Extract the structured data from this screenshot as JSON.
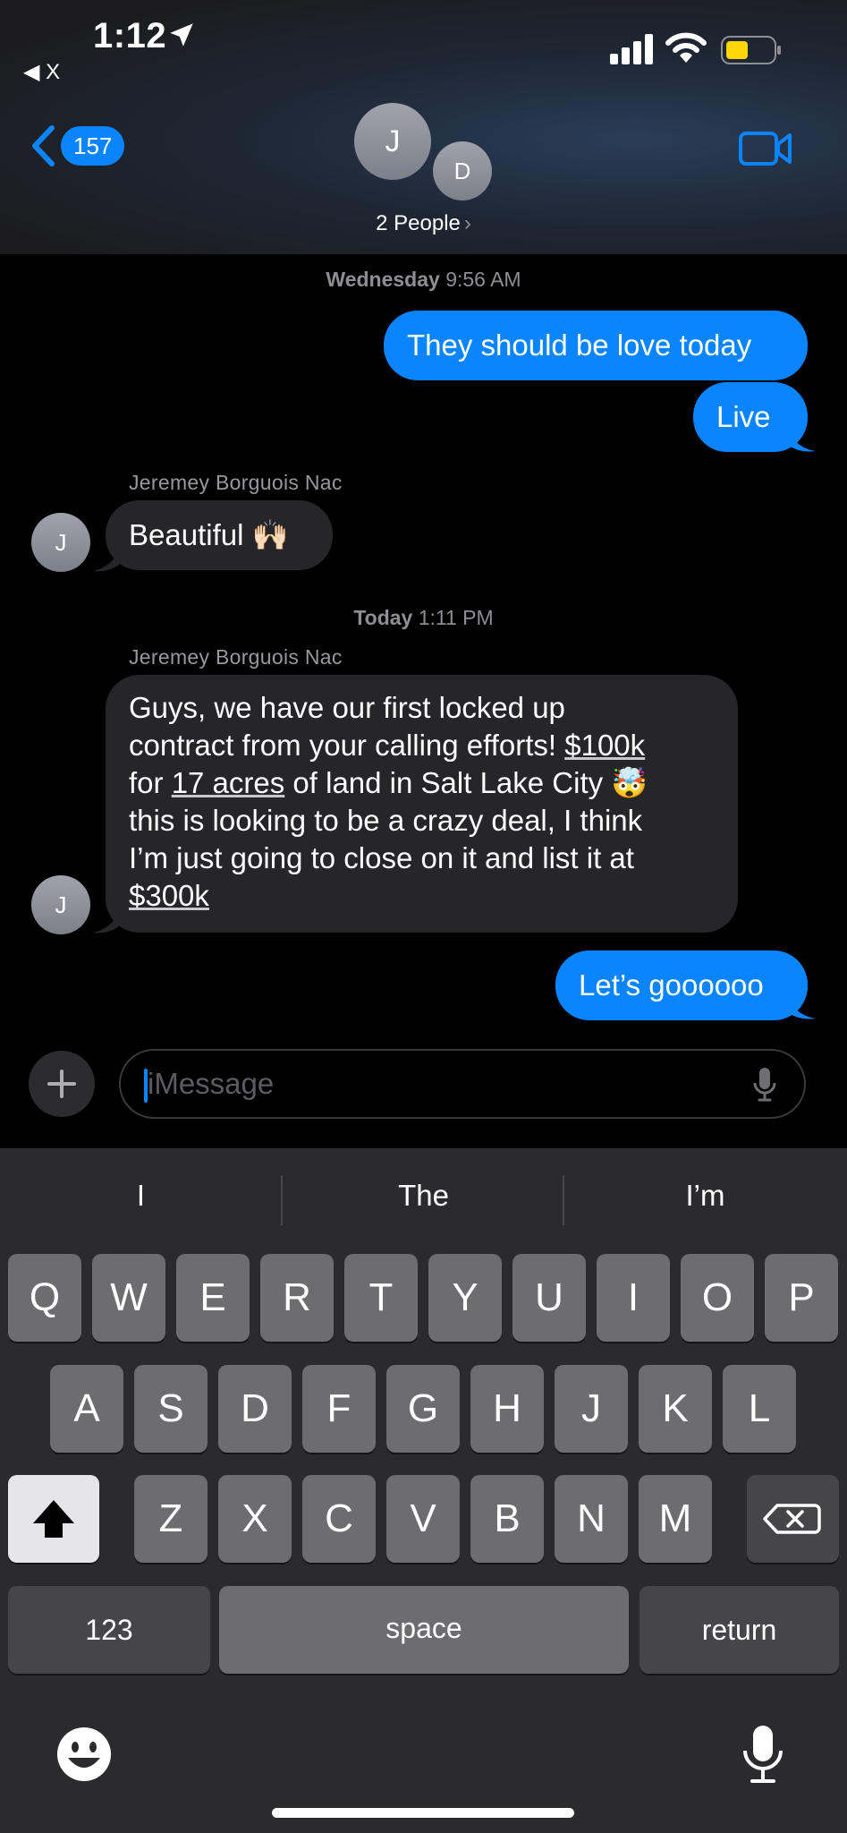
{
  "status_bar": {
    "time": "1:12",
    "back_app": "◀ X"
  },
  "header": {
    "back_count": "157",
    "avatar_primary": "J",
    "avatar_secondary": "D",
    "people_label": "2 People",
    "people_chevron": "›"
  },
  "icons": {
    "location": "location-arrow-icon",
    "signal": "cellular-signal-icon",
    "wifi": "wifi-icon",
    "battery": "battery-icon",
    "video": "video-camera-icon",
    "plus": "plus-icon",
    "dictation": "microphone-icon",
    "shift": "shift-icon",
    "delete": "delete-icon",
    "emoji": "emoji-icon",
    "keyboard_mic": "microphone-icon"
  },
  "colors": {
    "accent": "#0a84ff",
    "incoming_bubble": "#262629",
    "battery": "#ffd60a"
  },
  "conversation": {
    "ts1_day": "Wednesday",
    "ts1_time": "9:56 AM",
    "msg1": "They should be love today",
    "msg2": "Live",
    "sender1": "Jeremey Borguois Nac",
    "msg3": "Beautiful 🙌🏻",
    "avatar": "J",
    "ts2_day": "Today",
    "ts2_time": "1:11 PM",
    "sender2": "Jeremey Borguois Nac",
    "msg4": {
      "line1": "Guys, we have our first locked up",
      "line2_pre": "contract from your calling efforts! ",
      "line2_link": "$100k",
      "line3_pre": "for ",
      "line3_link": "17 acres",
      "line3_post": " of land in Salt Lake City 🤯",
      "line4": "this is looking to be a crazy deal, I think",
      "line5": "I’m just going to close on it and list it at",
      "line6_link": "$300k"
    },
    "msg5": "Let’s goooooo"
  },
  "input": {
    "placeholder": "iMessage"
  },
  "keyboard": {
    "suggestions": [
      "I",
      "The",
      "I’m"
    ],
    "row1": [
      "Q",
      "W",
      "E",
      "R",
      "T",
      "Y",
      "U",
      "I",
      "O",
      "P"
    ],
    "row2": [
      "A",
      "S",
      "D",
      "F",
      "G",
      "H",
      "J",
      "K",
      "L"
    ],
    "row3": [
      "Z",
      "X",
      "C",
      "V",
      "B",
      "N",
      "M"
    ],
    "numbers_label": "123",
    "space_label": "space",
    "return_label": "return"
  }
}
